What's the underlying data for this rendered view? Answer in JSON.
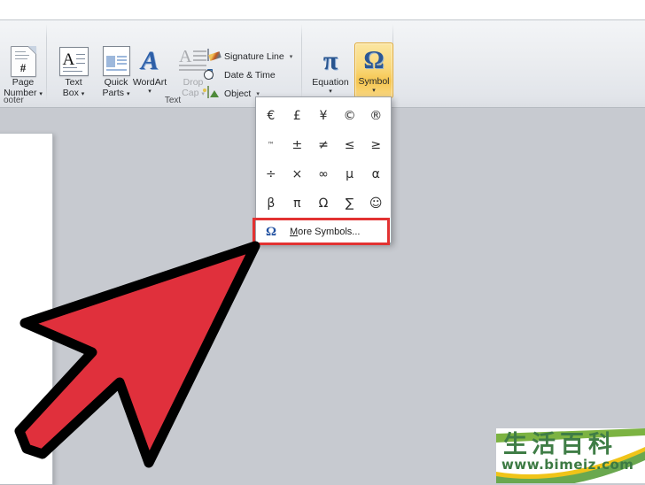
{
  "app": {
    "background_color": "#c7cad0",
    "ribbon_bg": "#eceef1"
  },
  "ribbon": {
    "groups": [
      {
        "name": "header-footer",
        "label": "ooter"
      },
      {
        "name": "text",
        "label": "Text"
      }
    ],
    "buttons": {
      "page_number": {
        "label_line1": "Page",
        "label_line2": "Number",
        "caret": "▾",
        "icon": "page-number-icon",
        "disabled": false
      },
      "text_box": {
        "label_line1": "Text",
        "label_line2": "Box",
        "caret": "▾",
        "icon": "text-box-icon",
        "disabled": false
      },
      "quick_parts": {
        "label_line1": "Quick",
        "label_line2": "Parts",
        "caret": "▾",
        "icon": "quick-parts-icon",
        "disabled": false
      },
      "wordart": {
        "label_line1": "WordArt",
        "label_line2": "",
        "caret": "▾",
        "icon": "wordart-icon",
        "disabled": false
      },
      "drop_cap": {
        "label_line1": "Drop",
        "label_line2": "Cap",
        "caret": "▾",
        "icon": "drop-cap-icon",
        "disabled": true
      },
      "equation": {
        "label_line1": "Equation",
        "label_line2": "",
        "caret": "▾",
        "icon": "equation-pi-icon",
        "disabled": false
      },
      "symbol": {
        "label_line1": "Symbol",
        "label_line2": "",
        "caret": "▾",
        "icon": "symbol-omega-icon",
        "disabled": false,
        "state": "active",
        "highlight_color": "#f6c650",
        "border_color": "#e0a82e"
      }
    },
    "small_buttons": [
      {
        "label": "Signature Line",
        "caret": "▾",
        "icon": "signature-line-icon"
      },
      {
        "label": "Date & Time",
        "caret": "",
        "icon": "date-time-icon"
      },
      {
        "label": "Object",
        "caret": "▾",
        "icon": "object-icon"
      }
    ]
  },
  "symbol_panel": {
    "symbols": [
      {
        "char": "€",
        "name": "euro-sign"
      },
      {
        "char": "£",
        "name": "pound-sign"
      },
      {
        "char": "¥",
        "name": "yen-sign"
      },
      {
        "char": "©",
        "name": "copyright-sign"
      },
      {
        "char": "®",
        "name": "registered-sign"
      },
      {
        "char": "™",
        "name": "trademark-sign"
      },
      {
        "char": "±",
        "name": "plus-minus-sign"
      },
      {
        "char": "≠",
        "name": "not-equal-sign"
      },
      {
        "char": "≤",
        "name": "less-than-equal-sign"
      },
      {
        "char": "≥",
        "name": "greater-than-equal-sign"
      },
      {
        "char": "÷",
        "name": "division-sign"
      },
      {
        "char": "×",
        "name": "multiplication-sign"
      },
      {
        "char": "∞",
        "name": "infinity-sign"
      },
      {
        "char": "µ",
        "name": "micro-sign"
      },
      {
        "char": "α",
        "name": "alpha-sign"
      },
      {
        "char": "β",
        "name": "beta-sign"
      },
      {
        "char": "π",
        "name": "pi-sign"
      },
      {
        "char": "Ω",
        "name": "omega-sign"
      },
      {
        "char": "∑",
        "name": "sigma-sign"
      },
      {
        "char": "☺",
        "name": "smiley-sign"
      }
    ],
    "more_symbols": {
      "icon_char": "Ω",
      "accelerator": "M",
      "label_rest": "ore Symbols...",
      "full_label": "More Symbols...",
      "highlight_border_color": "#e23232"
    }
  },
  "annotation": {
    "cursor": {
      "name": "red-arrow-cursor",
      "fill": "#e0303c",
      "stroke": "#000000"
    }
  },
  "watermark": {
    "chinese_text": "生活百科",
    "url": "www.bimeiz.com",
    "color": "#3f7d46"
  }
}
